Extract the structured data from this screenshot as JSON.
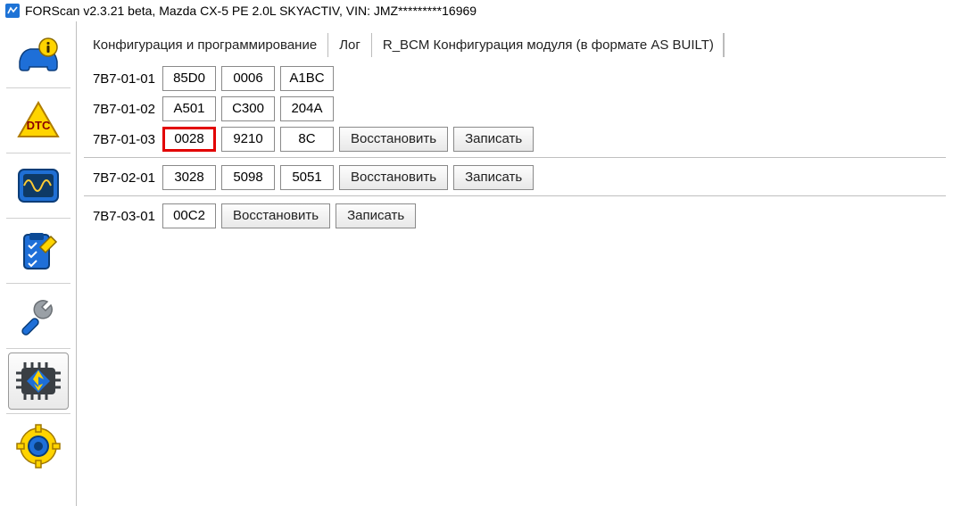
{
  "window": {
    "title": "FORScan v2.3.21 beta, Mazda CX-5 PE 2.0L SKYACTIV, VIN: JMZ*********16969"
  },
  "tabs": {
    "config": "Конфигурация и программирование",
    "log": "Лог",
    "module": "R_BCM Конфигурация модуля (в формате AS BUILT)"
  },
  "buttons": {
    "restore": "Восстановить",
    "write": "Записать"
  },
  "rows": [
    {
      "addr": "7B7-01-01",
      "cells": [
        "85D0",
        "0006",
        "A1BC"
      ],
      "actions": false,
      "highlight": null
    },
    {
      "addr": "7B7-01-02",
      "cells": [
        "A501",
        "C300",
        "204A"
      ],
      "actions": false,
      "highlight": null
    },
    {
      "addr": "7B7-01-03",
      "cells": [
        "0028",
        "9210",
        "8C"
      ],
      "actions": true,
      "highlight": 0
    },
    {
      "addr": "7B7-02-01",
      "cells": [
        "3028",
        "5098",
        "5051"
      ],
      "actions": true,
      "highlight": null,
      "sep_before": true
    },
    {
      "addr": "7B7-03-01",
      "cells": [
        "00C2"
      ],
      "actions": true,
      "highlight": null,
      "sep_before": true
    }
  ]
}
